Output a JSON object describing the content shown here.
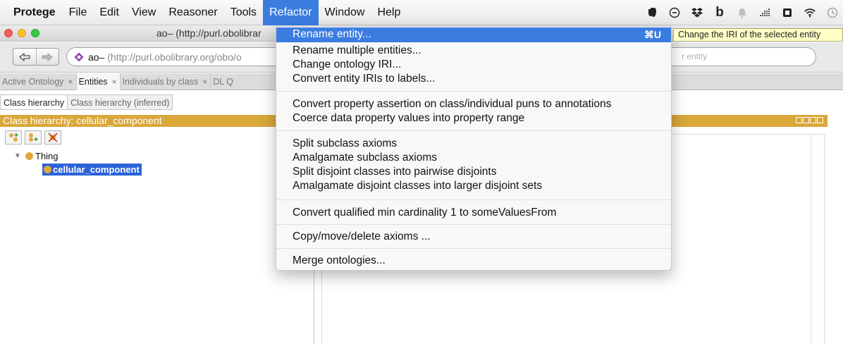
{
  "menubar": {
    "app": "Protege",
    "items": [
      "File",
      "Edit",
      "View",
      "Reasoner",
      "Tools",
      "Refactor",
      "Window",
      "Help"
    ],
    "active": "Refactor",
    "status_icons": [
      "evernote-icon",
      "minus-circle-icon",
      "dropbox-icon",
      "b-icon",
      "bell-icon",
      "grid-dots-icon",
      "lock-icon",
      "wifi-icon",
      "clock-icon"
    ]
  },
  "window": {
    "title": "ao– (http://purl.obolibrar"
  },
  "toolbar": {
    "back_icon": "back-arrow-icon",
    "forward_icon": "forward-arrow-icon",
    "address_name": "ao–",
    "address_url": "(http://purl.obolibrary.org/obo/o",
    "search_placeholder": "r entity"
  },
  "tabs": [
    {
      "label": "Active Ontology",
      "close": "×"
    },
    {
      "label": "Entities",
      "close": "×"
    },
    {
      "label": "Individuals by class",
      "close": "×"
    },
    {
      "label": "DL Q"
    }
  ],
  "left_panel": {
    "subtabs": [
      "Class hierarchy",
      "Class hierarchy (inferred)"
    ],
    "header": "Class hierarchy: cellular_component",
    "tools": [
      "add-subclass-icon",
      "add-sibling-icon",
      "delete-class-icon"
    ],
    "tree": {
      "root": "Thing",
      "child": "cellular_component"
    }
  },
  "refactor_menu": {
    "items": [
      {
        "label": "Rename entity...",
        "shortcut": "⌘U"
      },
      {
        "label": "Rename multiple entities..."
      },
      {
        "label": "Change ontology IRI..."
      },
      {
        "label": "Convert entity IRIs to labels..."
      },
      {
        "label": "Convert property assertion on class/individual puns to annotations"
      },
      {
        "label": "Coerce data property values into property range"
      },
      {
        "label": "Split subclass axioms"
      },
      {
        "label": "Amalgamate subclass axioms"
      },
      {
        "label": "Split disjoint classes into pairwise disjoints"
      },
      {
        "label": "Amalgamate disjoint classes into larger disjoint sets"
      },
      {
        "label": "Convert qualified min cardinality 1 to someValuesFrom"
      },
      {
        "label": "Copy/move/delete axioms ..."
      },
      {
        "label": "Merge ontologies..."
      }
    ]
  },
  "tooltip": "Change the IRI of the selected entity",
  "colors": {
    "menu_highlight": "#3b7ce0",
    "panel_header": "#d9a73a",
    "selection": "#2b63d9",
    "class_dot": "#e0a93c",
    "tooltip_bg": "#ffffc6"
  }
}
